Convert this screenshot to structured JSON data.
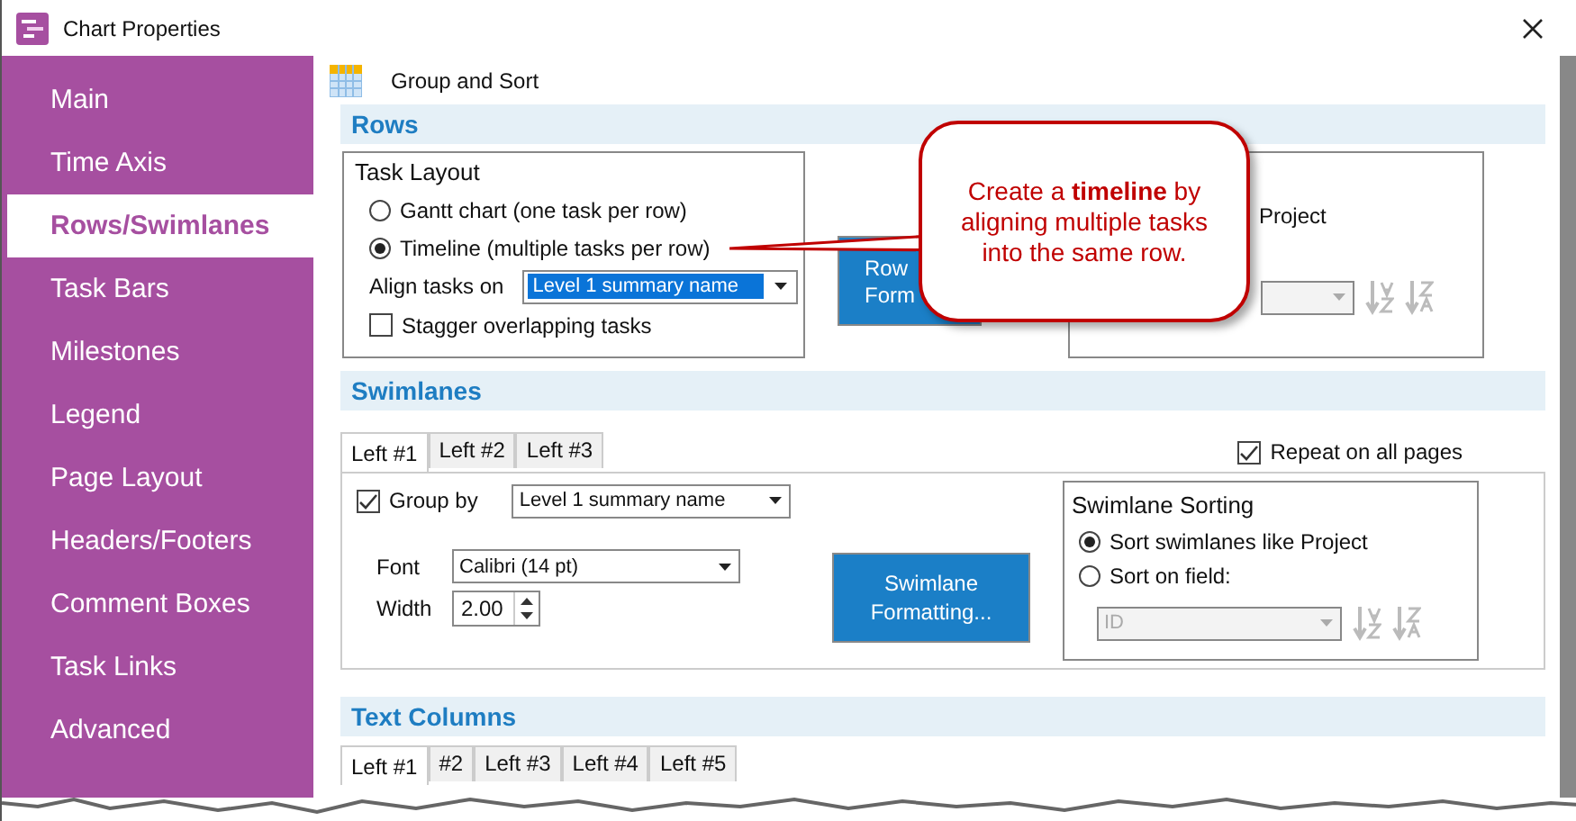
{
  "window": {
    "title": "Chart Properties"
  },
  "sidebar": {
    "items": [
      {
        "label": "Main",
        "selected": false
      },
      {
        "label": "Time Axis",
        "selected": false
      },
      {
        "label": "Rows/Swimlanes",
        "selected": true
      },
      {
        "label": "Task Bars",
        "selected": false
      },
      {
        "label": "Milestones",
        "selected": false
      },
      {
        "label": "Legend",
        "selected": false
      },
      {
        "label": "Page Layout",
        "selected": false
      },
      {
        "label": "Headers/Footers",
        "selected": false
      },
      {
        "label": "Comment Boxes",
        "selected": false
      },
      {
        "label": "Task Links",
        "selected": false
      },
      {
        "label": "Advanced",
        "selected": false
      }
    ]
  },
  "page_header": {
    "title": "Group and Sort"
  },
  "rows": {
    "heading": "Rows",
    "task_layout": {
      "title": "Task Layout",
      "options": [
        {
          "label": "Gantt chart (one task per row)",
          "selected": false
        },
        {
          "label": "Timeline (multiple tasks per row)",
          "selected": true
        }
      ],
      "align_label": "Align tasks on",
      "align_value": "Level 1 summary name",
      "stagger": {
        "label": "Stagger overlapping tasks",
        "checked": false
      }
    },
    "formatting_button": [
      "Row",
      "Form"
    ],
    "sorting": {
      "option_label": "Project"
    }
  },
  "callout": "Create a **timeline** by aligning multiple tasks into the same row.",
  "swimlanes": {
    "heading": "Swimlanes",
    "tabs": [
      {
        "label": "Left #1",
        "selected": true
      },
      {
        "label": "Left #2",
        "selected": false
      },
      {
        "label": "Left #3",
        "selected": false
      }
    ],
    "repeat": {
      "label": "Repeat on all pages",
      "checked": true
    },
    "group_by": {
      "label": "Group by",
      "checked": true,
      "value": "Level 1 summary name"
    },
    "font": {
      "label": "Font",
      "value": "Calibri (14 pt)"
    },
    "width": {
      "label": "Width",
      "value": "2.00"
    },
    "formatting_button": "Swimlane Formatting...",
    "sorting": {
      "title": "Swimlane Sorting",
      "options": [
        {
          "label": "Sort swimlanes like Project",
          "selected": true
        },
        {
          "label": "Sort on field:",
          "selected": false
        }
      ],
      "field_value": "ID"
    }
  },
  "text_columns": {
    "heading": "Text Columns",
    "tabs": [
      {
        "label": "Left #1",
        "selected": true
      },
      {
        "label": "#2",
        "selected": false
      },
      {
        "label": "Left #3",
        "selected": false
      },
      {
        "label": "Left #4",
        "selected": false
      },
      {
        "label": "Left #5",
        "selected": false
      }
    ]
  }
}
